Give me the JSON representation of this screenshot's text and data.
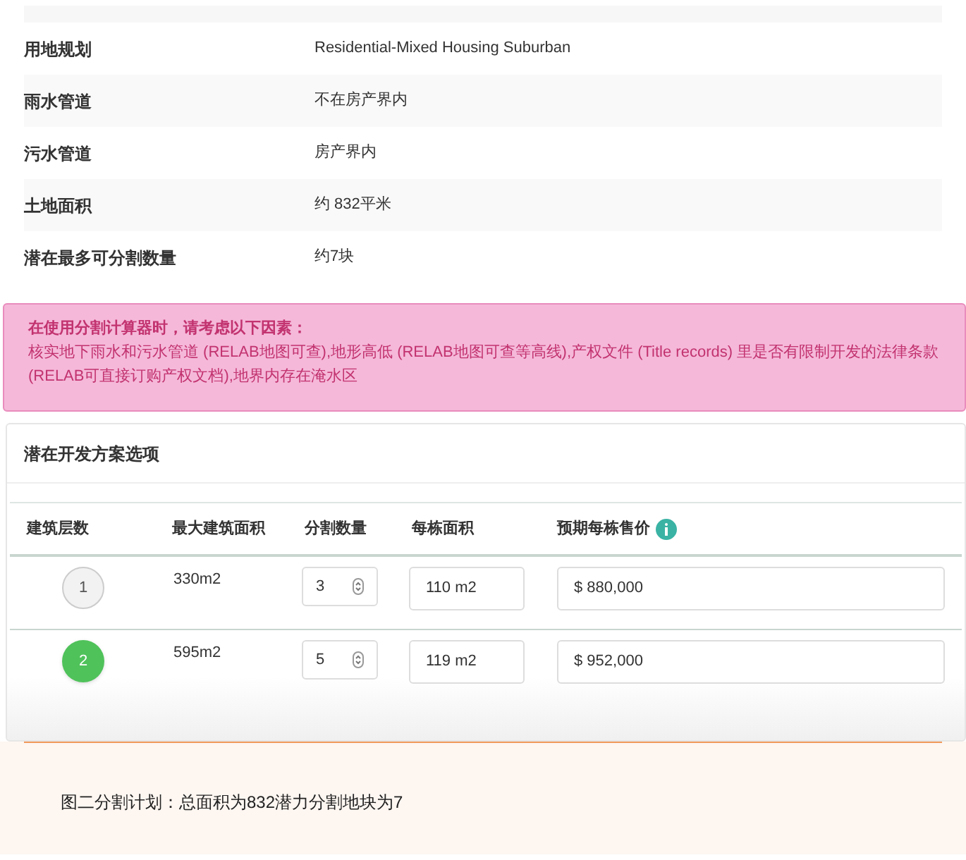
{
  "properties": [
    {
      "label": "用地规划",
      "value": "Residential-Mixed Housing Suburban"
    },
    {
      "label": "雨水管道",
      "value": "不在房产界内"
    },
    {
      "label": "污水管道",
      "value": "房产界内"
    },
    {
      "label": "土地面积",
      "value": "约 832平米"
    },
    {
      "label": "潜在最多可分割数量",
      "value": "约7块"
    }
  ],
  "alert": {
    "title": "在使用分割计算器时，请考虑以下因素：",
    "body": "核实地下雨水和污水管道 (RELAB地图可查),地形高低 (RELAB地图可查等高线),产权文件 (Title records) 里是否有限制开发的法律条款(RELAB可直接订购产权文档),地界内存在淹水区"
  },
  "options": {
    "title": "潜在开发方案选项",
    "columns": [
      "建筑层数",
      "最大建筑面积",
      "分割数量",
      "每栋面积",
      "预期每栋售价"
    ],
    "rows": [
      {
        "floors": "1",
        "selected": false,
        "max_area": "330m2",
        "count": "3",
        "unit_area": "110 m2",
        "price": "$ 880,000"
      },
      {
        "floors": "2",
        "selected": true,
        "max_area": "595m2",
        "count": "5",
        "unit_area": "119 m2",
        "price": "$ 952,000"
      }
    ]
  },
  "caption": "图二分割计划：总面积为832潜力分割地块为7"
}
